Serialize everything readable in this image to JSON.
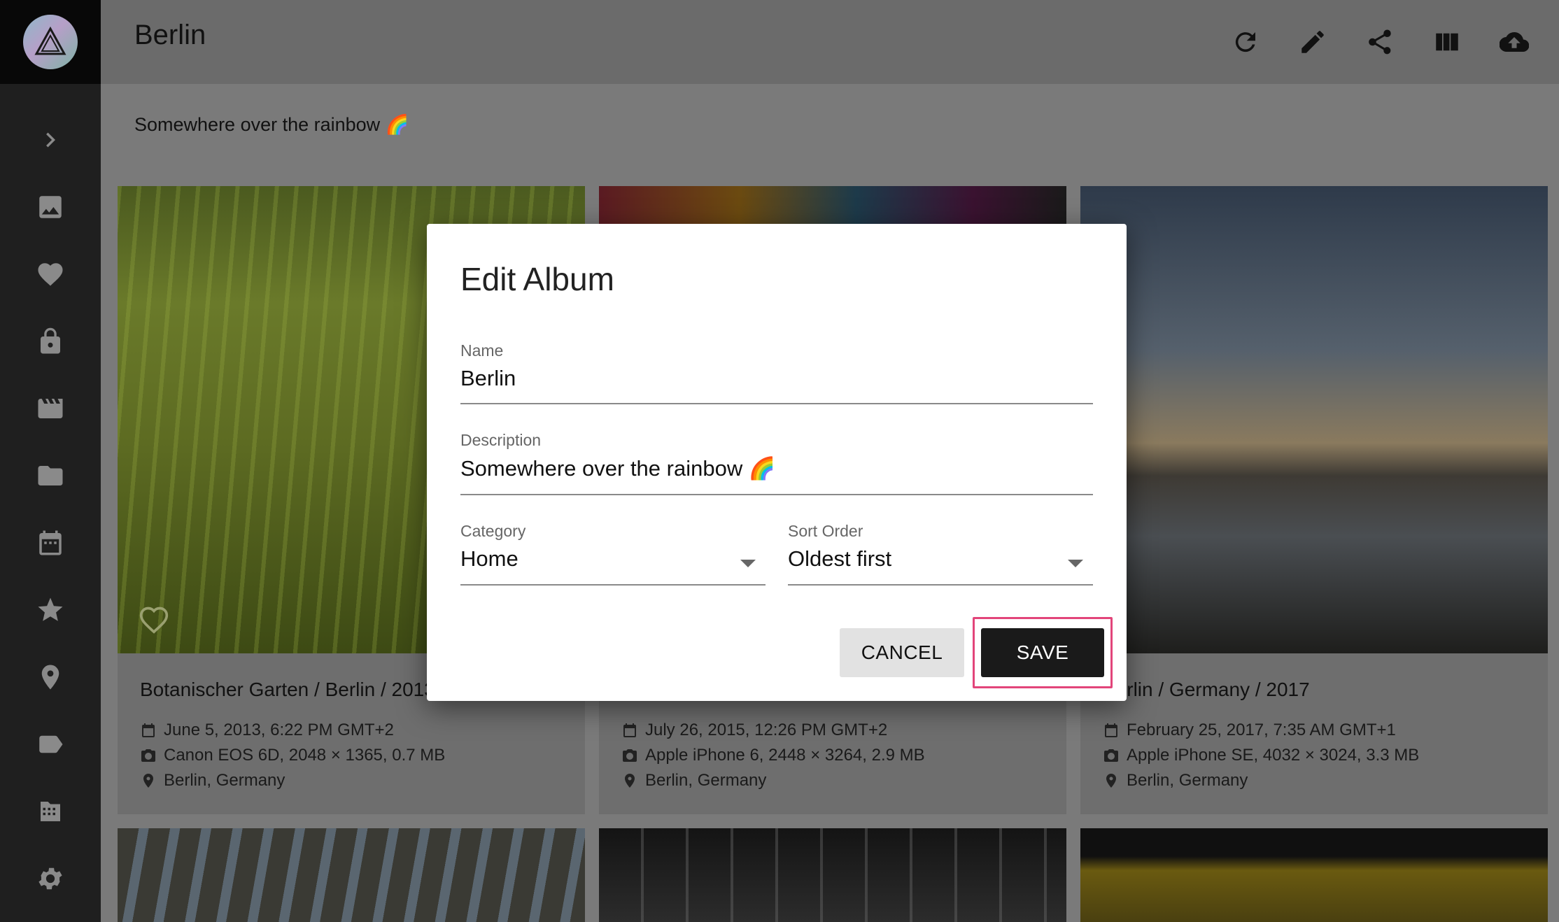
{
  "app": {
    "logo_icon": "prism-triangle-logo"
  },
  "sidebar": {
    "items": [
      {
        "name": "expand",
        "icon": "chevron-right-icon"
      },
      {
        "name": "photos",
        "icon": "image-icon"
      },
      {
        "name": "favorites",
        "icon": "heart-icon"
      },
      {
        "name": "private",
        "icon": "lock-icon"
      },
      {
        "name": "videos",
        "icon": "movie-icon"
      },
      {
        "name": "folders",
        "icon": "folder-icon"
      },
      {
        "name": "calendar",
        "icon": "calendar-icon"
      },
      {
        "name": "moments",
        "icon": "star-icon"
      },
      {
        "name": "places",
        "icon": "location-pin-icon"
      },
      {
        "name": "labels",
        "icon": "label-tag-icon"
      },
      {
        "name": "library",
        "icon": "library-icon"
      },
      {
        "name": "settings",
        "icon": "gear-icon"
      }
    ]
  },
  "header": {
    "title": "Berlin",
    "actions": [
      "refresh-icon",
      "edit-pencil-icon",
      "share-icon",
      "view-columns-icon",
      "cloud-upload-icon"
    ]
  },
  "album": {
    "description": "Somewhere over the rainbow 🌈"
  },
  "cards": [
    {
      "title": "Botanischer Garten / Berlin / 2013",
      "date": "June 5, 2013, 6:22 PM GMT+2",
      "camera": "Canon EOS 6D, 2048 × 1365, 0.7 MB",
      "location": "Berlin, Germany"
    },
    {
      "title": "",
      "date": "July 26, 2015, 12:26 PM GMT+2",
      "camera": "Apple iPhone 6, 2448 × 3264, 2.9 MB",
      "location": "Berlin, Germany"
    },
    {
      "title": "Berlin / Germany / 2017",
      "date": "February 25, 2017, 7:35 AM GMT+1",
      "camera": "Apple iPhone SE, 4032 × 3024, 3.3 MB",
      "location": "Berlin, Germany"
    }
  ],
  "dialog": {
    "title": "Edit Album",
    "name_label": "Name",
    "name_value": "Berlin",
    "description_label": "Description",
    "description_value": "Somewhere over the rainbow 🌈",
    "category_label": "Category",
    "category_value": "Home",
    "sort_label": "Sort Order",
    "sort_value": "Oldest first",
    "cancel_label": "CANCEL",
    "save_label": "SAVE",
    "highlight_color": "#e2457a"
  }
}
